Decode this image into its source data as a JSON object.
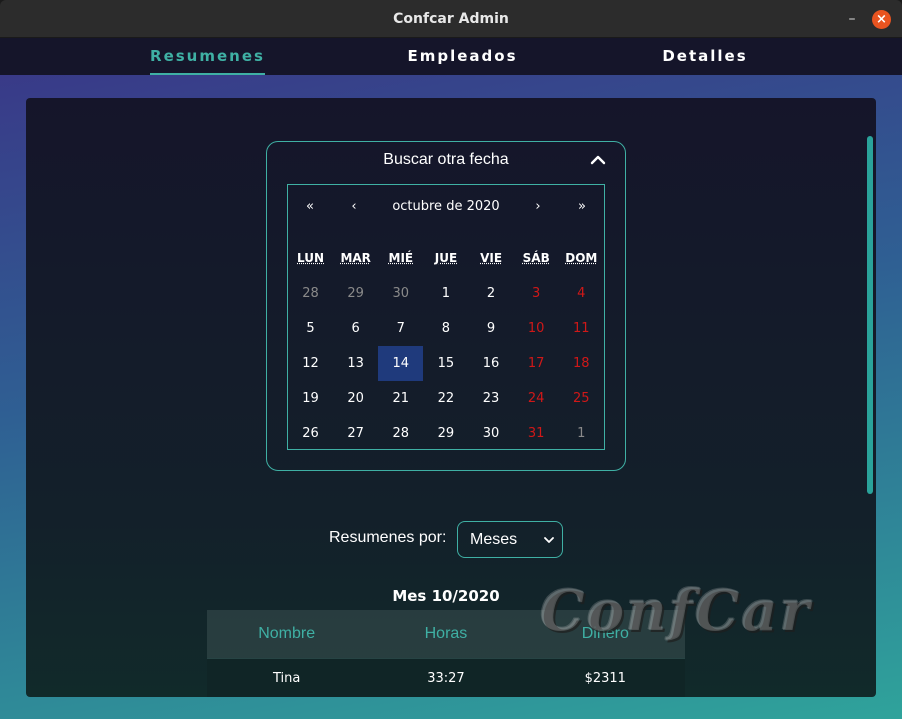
{
  "window": {
    "title": "Confcar Admin"
  },
  "nav": {
    "tabs": [
      {
        "label": "Resumenes"
      },
      {
        "label": "Empleados"
      },
      {
        "label": "Detalles"
      }
    ]
  },
  "date_picker": {
    "header": "Buscar otra fecha",
    "month_label": "octubre de 2020",
    "prev_year": "«",
    "prev_month": "‹",
    "next_month": "›",
    "next_year": "»",
    "weekdays": [
      "LUN",
      "MAR",
      "MIÉ",
      "JUE",
      "VIE",
      "SÁB",
      "DOM"
    ],
    "weeks": [
      [
        "28",
        "29",
        "30",
        "1",
        "2",
        "3",
        "4"
      ],
      [
        "5",
        "6",
        "7",
        "8",
        "9",
        "10",
        "11"
      ],
      [
        "12",
        "13",
        "14",
        "15",
        "16",
        "17",
        "18"
      ],
      [
        "19",
        "20",
        "21",
        "22",
        "23",
        "24",
        "25"
      ],
      [
        "26",
        "27",
        "28",
        "29",
        "30",
        "31",
        "1"
      ]
    ],
    "selected_day": "14"
  },
  "summary": {
    "label": "Resumenes por:",
    "selected": "Meses"
  },
  "month_title": "Mes 10/2020",
  "table": {
    "headers": [
      "Nombre",
      "Horas",
      "Dinero"
    ],
    "rows": [
      [
        "Tina",
        "33:27",
        "$2311"
      ]
    ]
  },
  "watermark": "ConfCar",
  "colors": {
    "accent": "#3fb0a4",
    "close": "#e95420",
    "weekend": "#d01818",
    "selected": "#1f3a7c"
  }
}
